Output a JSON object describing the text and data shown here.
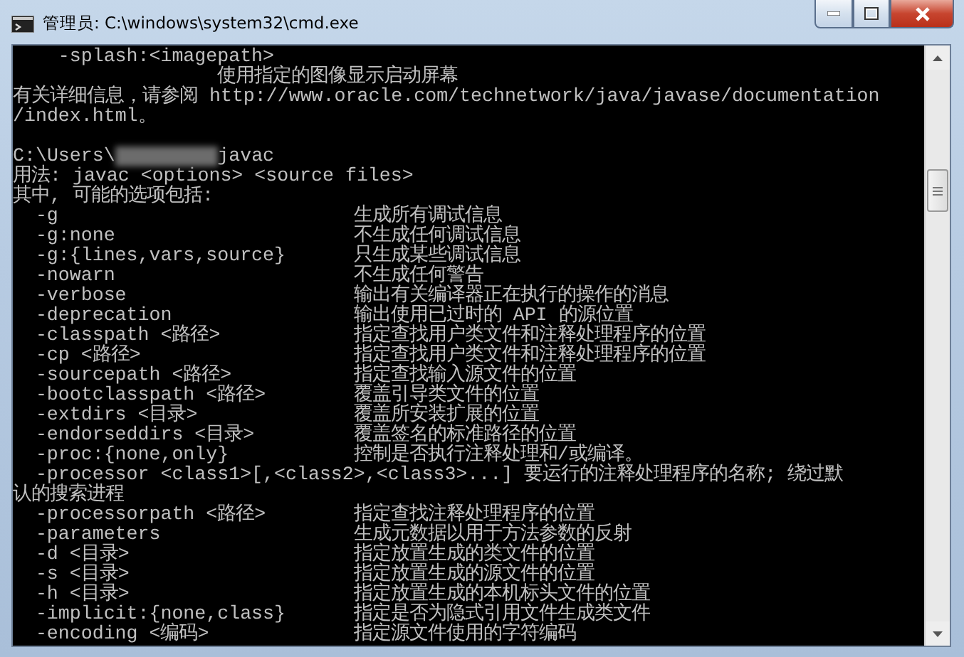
{
  "window": {
    "title": "管理员: C:\\windows\\system32\\cmd.exe"
  },
  "console": {
    "lines": [
      {
        "kind": "subopt",
        "text": "-splash:<imagepath>"
      },
      {
        "kind": "note",
        "text": "使用指定的图像显示启动屏幕"
      },
      {
        "kind": "text",
        "text": "有关详细信息，请参阅 http://www.oracle.com/technetwork/java/javase/documentation"
      },
      {
        "kind": "text",
        "text": "/index.html。"
      },
      {
        "kind": "blank"
      },
      {
        "kind": "prompt",
        "path": "C:\\Users\\",
        "command": "javac"
      },
      {
        "kind": "text",
        "text": "用法: javac <options> <source files>"
      },
      {
        "kind": "text",
        "text": "其中, 可能的选项包括:"
      },
      {
        "kind": "option",
        "option": "-g",
        "description": "生成所有调试信息"
      },
      {
        "kind": "option",
        "option": "-g:none",
        "description": "不生成任何调试信息"
      },
      {
        "kind": "option",
        "option": "-g:{lines,vars,source}",
        "description": "只生成某些调试信息"
      },
      {
        "kind": "option",
        "option": "-nowarn",
        "description": "不生成任何警告"
      },
      {
        "kind": "option",
        "option": "-verbose",
        "description": "输出有关编译器正在执行的操作的消息"
      },
      {
        "kind": "option",
        "option": "-deprecation",
        "description": "输出使用已过时的 API 的源位置"
      },
      {
        "kind": "option",
        "option": "-classpath <路径>",
        "description": "指定查找用户类文件和注释处理程序的位置"
      },
      {
        "kind": "option",
        "option": "-cp <路径>",
        "description": "指定查找用户类文件和注释处理程序的位置"
      },
      {
        "kind": "option",
        "option": "-sourcepath <路径>",
        "description": "指定查找输入源文件的位置"
      },
      {
        "kind": "option",
        "option": "-bootclasspath <路径>",
        "description": "覆盖引导类文件的位置"
      },
      {
        "kind": "option",
        "option": "-extdirs <目录>",
        "description": "覆盖所安装扩展的位置"
      },
      {
        "kind": "option",
        "option": "-endorseddirs <目录>",
        "description": "覆盖签名的标准路径的位置"
      },
      {
        "kind": "option",
        "option": "-proc:{none,only}",
        "description": "控制是否执行注释处理和/或编译。"
      },
      {
        "kind": "option",
        "option": "-processor <class1>[,<class2>,<class3>...]",
        "description": "要运行的注释处理程序的名称; 绕过默"
      },
      {
        "kind": "text",
        "text": "认的搜索进程"
      },
      {
        "kind": "option",
        "option": "-processorpath <路径>",
        "description": "指定查找注释处理程序的位置"
      },
      {
        "kind": "option",
        "option": "-parameters",
        "description": "生成元数据以用于方法参数的反射"
      },
      {
        "kind": "option",
        "option": "-d <目录>",
        "description": "指定放置生成的类文件的位置"
      },
      {
        "kind": "option",
        "option": "-s <目录>",
        "description": "指定放置生成的源文件的位置"
      },
      {
        "kind": "option",
        "option": "-h <目录>",
        "description": "指定放置生成的本机标头文件的位置"
      },
      {
        "kind": "option",
        "option": "-implicit:{none,class}",
        "description": "指定是否为隐式引用文件生成类文件"
      },
      {
        "kind": "option",
        "option": "-encoding <编码>",
        "description": "指定源文件使用的字符编码"
      }
    ]
  }
}
